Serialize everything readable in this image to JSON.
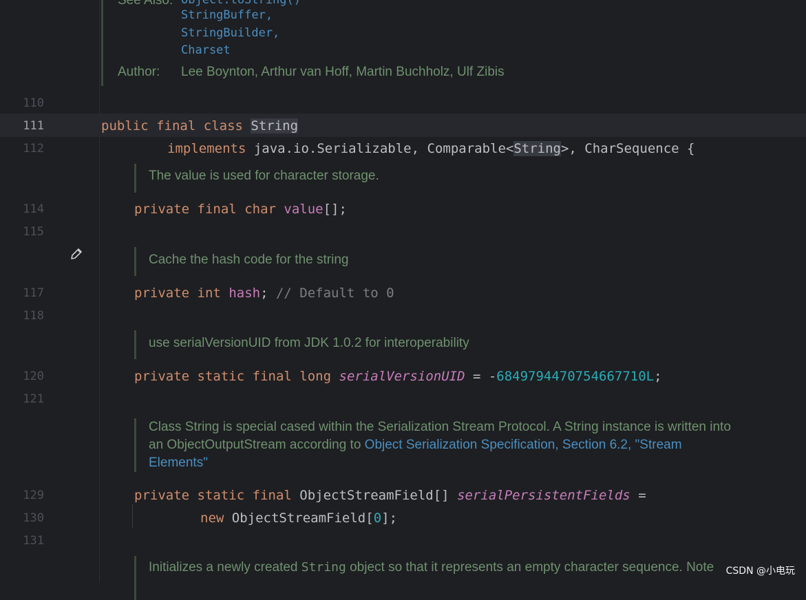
{
  "top_doc": {
    "see_also_label": "See Also:",
    "see_also_items": [
      "Object.toString()",
      "StringBuffer,",
      "StringBuilder,",
      "Charset"
    ],
    "author_label": "Author:",
    "authors": "Lee Boynton, Arthur van Hoff, Martin Buchholz, Ulf Zibis"
  },
  "line_numbers": {
    "l110": "110",
    "l111": "111",
    "l112": "112",
    "l114": "114",
    "l115": "115",
    "l117": "117",
    "l118": "118",
    "l120": "120",
    "l121": "121",
    "l129": "129",
    "l130": "130",
    "l131": "131"
  },
  "code": {
    "line111": {
      "k1": "public",
      "k2": "final",
      "k3": "class",
      "name": "String"
    },
    "line112": {
      "kw": "implements",
      "t1": "java.io.Serializable, Comparable<",
      "gen": "String",
      "t2": ">, CharSequence {"
    },
    "line114": {
      "k1": "private",
      "k2": "final",
      "k3": "char",
      "field": "value",
      "rest": "[];"
    },
    "line117": {
      "k1": "private",
      "k2": "int",
      "field": "hash",
      "semi": ";",
      "comment": "// Default to 0"
    },
    "line120": {
      "k1": "private",
      "k2": "static",
      "k3": "final",
      "k4": "long",
      "field": "serialVersionUID",
      "eq": " = -",
      "num": "6849794470754667710L",
      "semi": ";"
    },
    "line129": {
      "k1": "private",
      "k2": "static",
      "k3": "final",
      "type": "ObjectStreamField[]",
      "field": "serialPersistentFields",
      "eq": " ="
    },
    "line130": {
      "kw": "new",
      "t1": "ObjectStreamField[",
      "num": "0",
      "t2": "];"
    }
  },
  "docs": {
    "value": "The value is used for character storage.",
    "hash": "Cache the hash code for the string",
    "serial": "use serialVersionUID from JDK 1.0.2 for interoperability",
    "special_1": "Class String is special cased within the Serialization Stream Protocol. A String instance is written into",
    "special_2a": "an ObjectOutputStream according to ",
    "special_link_a": "Object Serialization Specification, Section 6.2, \"Stream",
    "special_link_b": "Elements\"",
    "init_a": "Initializes a newly created ",
    "init_mono": "String",
    "init_b": " object so that it represents an empty character sequence. Note"
  },
  "watermark": "CSDN @小电玩",
  "icons": {
    "edit": "pencil-icon"
  }
}
